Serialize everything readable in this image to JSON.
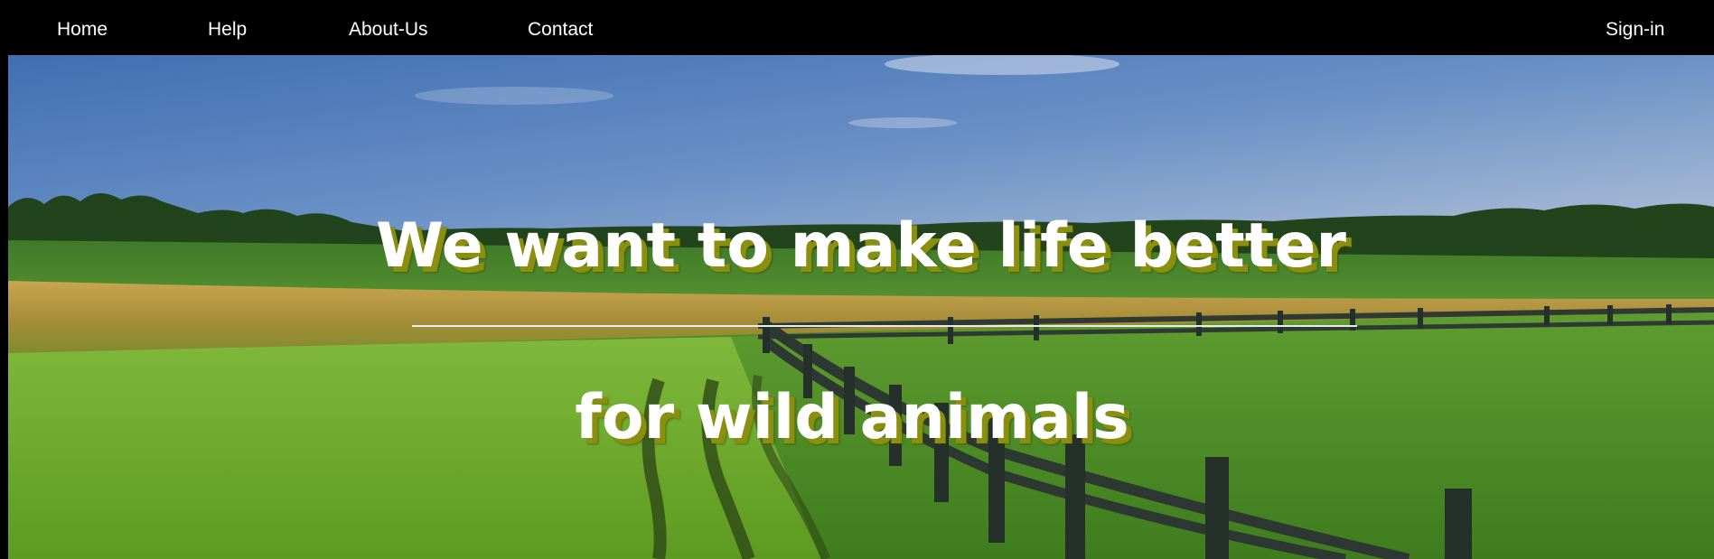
{
  "nav": {
    "home": "Home",
    "help": "Help",
    "about": "About-Us",
    "contact": "Contact",
    "signin": "Sign-in"
  },
  "hero": {
    "headline_line1": "We want to make life better",
    "headline_line2": "for wild animals"
  },
  "colors": {
    "navbar_bg": "#000000",
    "nav_text": "#ffffff",
    "headline_text": "#ffffff",
    "headline_shadow": "#8a8f10",
    "sky": "#5b86c4",
    "grass": "#6aa82c"
  }
}
